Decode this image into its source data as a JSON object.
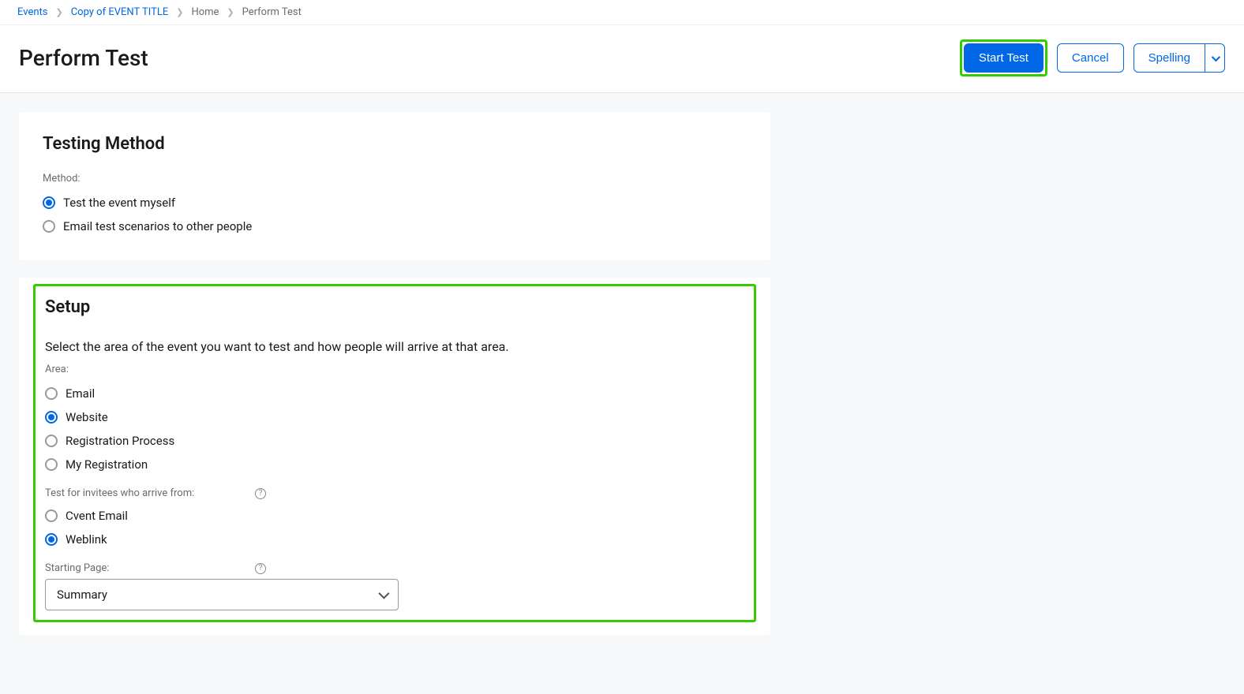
{
  "breadcrumb": {
    "events": "Events",
    "event_title": "Copy of EVENT TITLE",
    "home": "Home",
    "current": "Perform Test"
  },
  "header": {
    "title": "Perform Test",
    "start_test": "Start Test",
    "cancel": "Cancel",
    "spelling": "Spelling"
  },
  "testing_method": {
    "title": "Testing Method",
    "method_label": "Method:",
    "options": {
      "self": "Test the event myself",
      "email": "Email test scenarios to other people"
    }
  },
  "setup": {
    "title": "Setup",
    "description": "Select the area of the event you want to test and how people will arrive at that area.",
    "area_label": "Area:",
    "area_options": {
      "email": "Email",
      "website": "Website",
      "registration": "Registration Process",
      "my_registration": "My Registration"
    },
    "arrive_label": "Test for invitees who arrive from:",
    "arrive_options": {
      "cvent_email": "Cvent Email",
      "weblink": "Weblink"
    },
    "starting_page_label": "Starting Page:",
    "starting_page_value": "Summary"
  }
}
